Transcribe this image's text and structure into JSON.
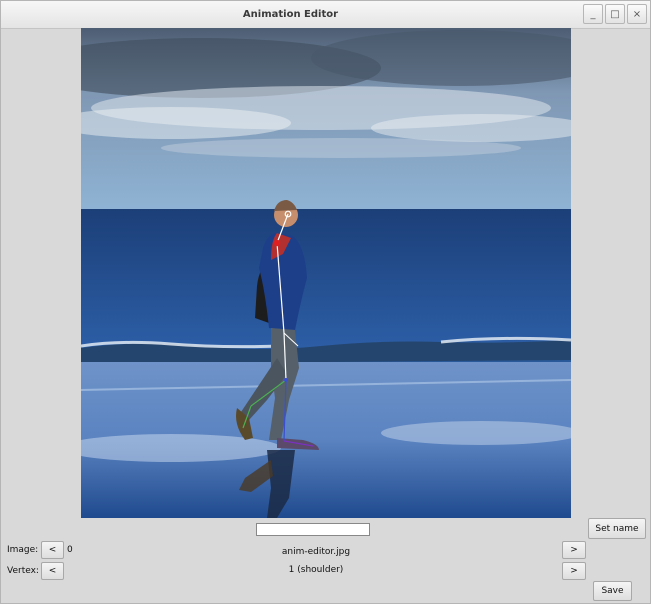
{
  "window": {
    "title": "Animation Editor",
    "minimize": "_",
    "maximize": "□",
    "close": "×"
  },
  "image_row": {
    "label": "Image:",
    "prev": "<",
    "index": "0",
    "filename": "anim-editor.jpg",
    "next": ">"
  },
  "vertex_row": {
    "label": "Vertex:",
    "prev": "<",
    "current": "1 (shoulder)",
    "next": ">"
  },
  "name_field": {
    "value": "",
    "set_label": "Set name"
  },
  "save_label": "Save",
  "colors": {
    "background": "#d9d9d9",
    "skeleton_main": "#ffffff",
    "skeleton_leg": "#4caf50",
    "skeleton_foot": "#3a4fd0",
    "selected_vertex": "#e02020"
  }
}
